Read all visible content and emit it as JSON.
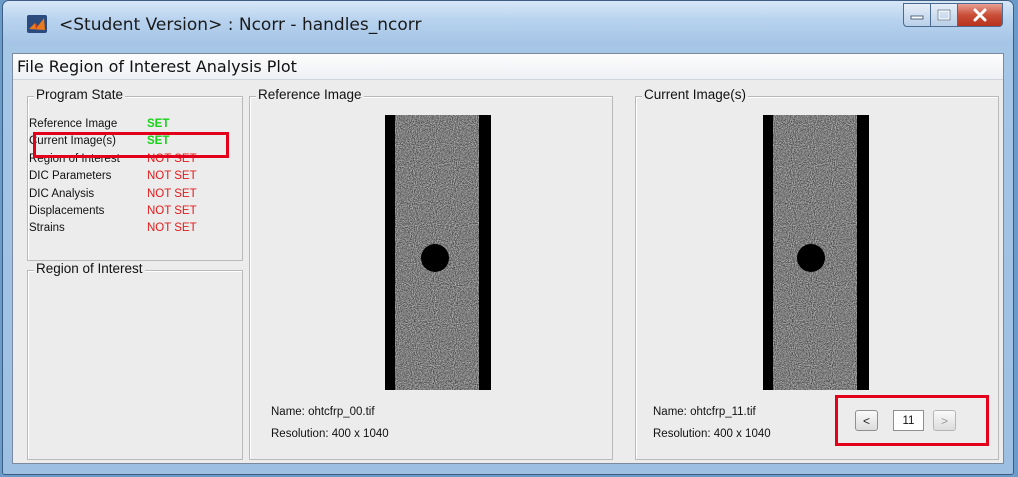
{
  "window": {
    "title": "<Student Version> : Ncorr - handles_ncorr"
  },
  "menu": [
    "File",
    "Region of Interest",
    "Analysis",
    "Plot"
  ],
  "program_state": {
    "title": "Program State",
    "rows": [
      {
        "label": "Reference Image",
        "value": "SET",
        "status": "set"
      },
      {
        "label": "Current Image(s)",
        "value": "SET",
        "status": "set"
      },
      {
        "label": "Region of Interest",
        "value": "NOT SET",
        "status": "notset"
      },
      {
        "label": "DIC Parameters",
        "value": "NOT SET",
        "status": "notset"
      },
      {
        "label": "DIC Analysis",
        "value": "NOT SET",
        "status": "notset"
      },
      {
        "label": "Displacements",
        "value": "NOT SET",
        "status": "notset"
      },
      {
        "label": "Strains",
        "value": "NOT SET",
        "status": "notset"
      }
    ],
    "colors": {
      "set": "#18d318",
      "notset": "#e21b1b"
    }
  },
  "roi_panel": {
    "title": "Region of Interest"
  },
  "reference": {
    "title": "Reference Image",
    "name": "Name: ohtcfrp_00.tif",
    "resolution": "Resolution: 400 x 1040"
  },
  "current": {
    "title": "Current Image(s)",
    "name": "Name: ohtcfrp_11.tif",
    "resolution": "Resolution: 400 x 1040",
    "prev_label": "<",
    "index": "11",
    "next_label": ">"
  },
  "icons": {
    "app": "matlab-icon",
    "minimize": "minimize-icon",
    "maximize": "maximize-icon",
    "close": "close-icon"
  },
  "highlight_color": "#e3001b"
}
